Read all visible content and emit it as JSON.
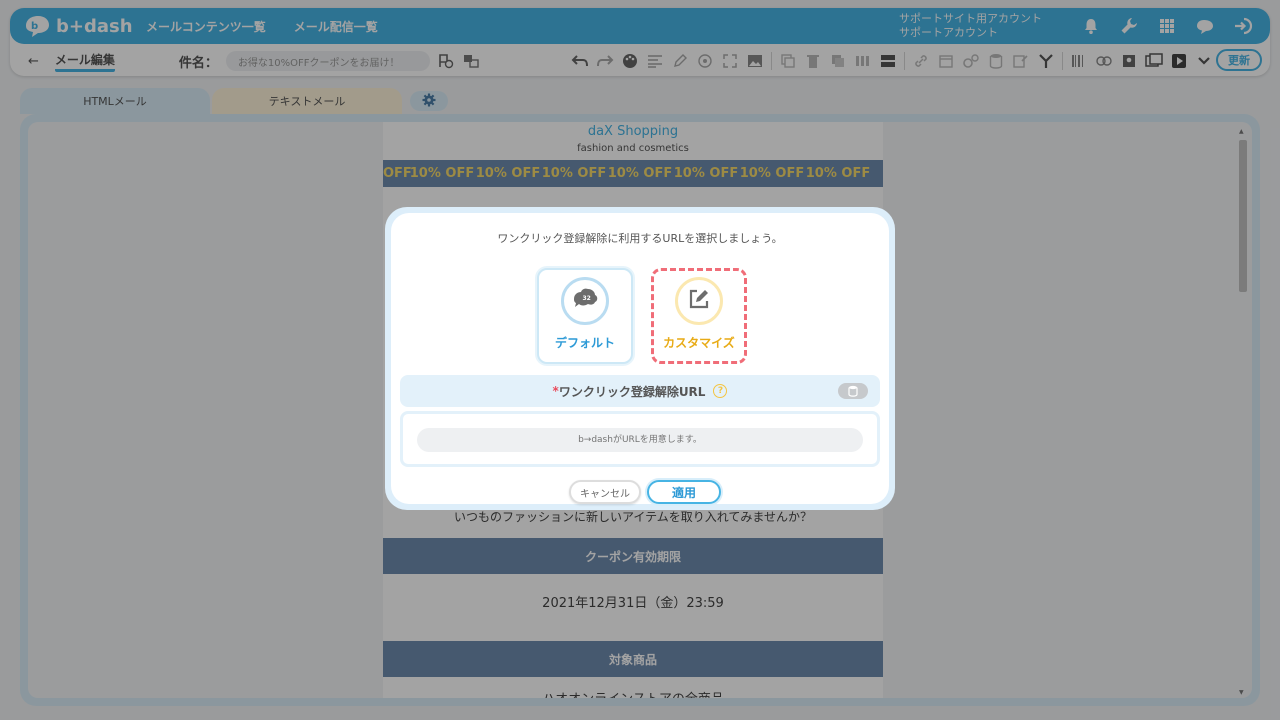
{
  "colors": {
    "brand": "#47b4e4",
    "banner": "#6e8cae",
    "banner_text": "#f6d96b",
    "custom_accent": "#e8ab16",
    "highlight_dash": "#f06d78"
  },
  "header": {
    "logo_text": "b+dash",
    "nav": [
      "メールコンテンツ一覧",
      "メール配信一覧"
    ],
    "account_line1": "サポートサイト用アカウント",
    "account_line2": "サポートアカウント",
    "icons": [
      "bell-icon",
      "wrench-icon",
      "grid-icon",
      "chat-cloud-icon",
      "logout-icon"
    ]
  },
  "toolbar": {
    "back_label": "←",
    "breadcrumb": "メール編集",
    "subject_label": "件名：",
    "subject_value": "お得な10%OFFクーポンをお届け！",
    "update_label": "更新"
  },
  "tabs": {
    "html": "HTMLメール",
    "text": "テキストメール"
  },
  "mail": {
    "shop_name": "daX Shopping",
    "shop_tagline": "fashion and cosmetics",
    "banner_items": [
      "OFF",
      "10% OFF",
      "10% OFF",
      "10% OFF",
      "10% OFF",
      "10% OFF",
      "10% OFF",
      "10% OFF"
    ],
    "body_text": "いつものファッションに新しいアイテムを取り入れてみませんか？",
    "coupon_heading": "クーポン有効期限",
    "coupon_date": "2021年12月31日（金）23:59",
    "products_heading": "対象商品",
    "products_text": "ハオオンラインストアの全商品"
  },
  "modal": {
    "title": "ワンクリック登録解除に利用するURLを選択しましょう。",
    "option_default": "デフォルト",
    "option_custom": "カスタマイズ",
    "required_mark": "*",
    "field_label": "ワンクリック登録解除URL",
    "help_mark": "?",
    "url_placeholder": "b→dashがURLを用意します。",
    "cancel_label": "キャンセル",
    "apply_label": "適用"
  }
}
